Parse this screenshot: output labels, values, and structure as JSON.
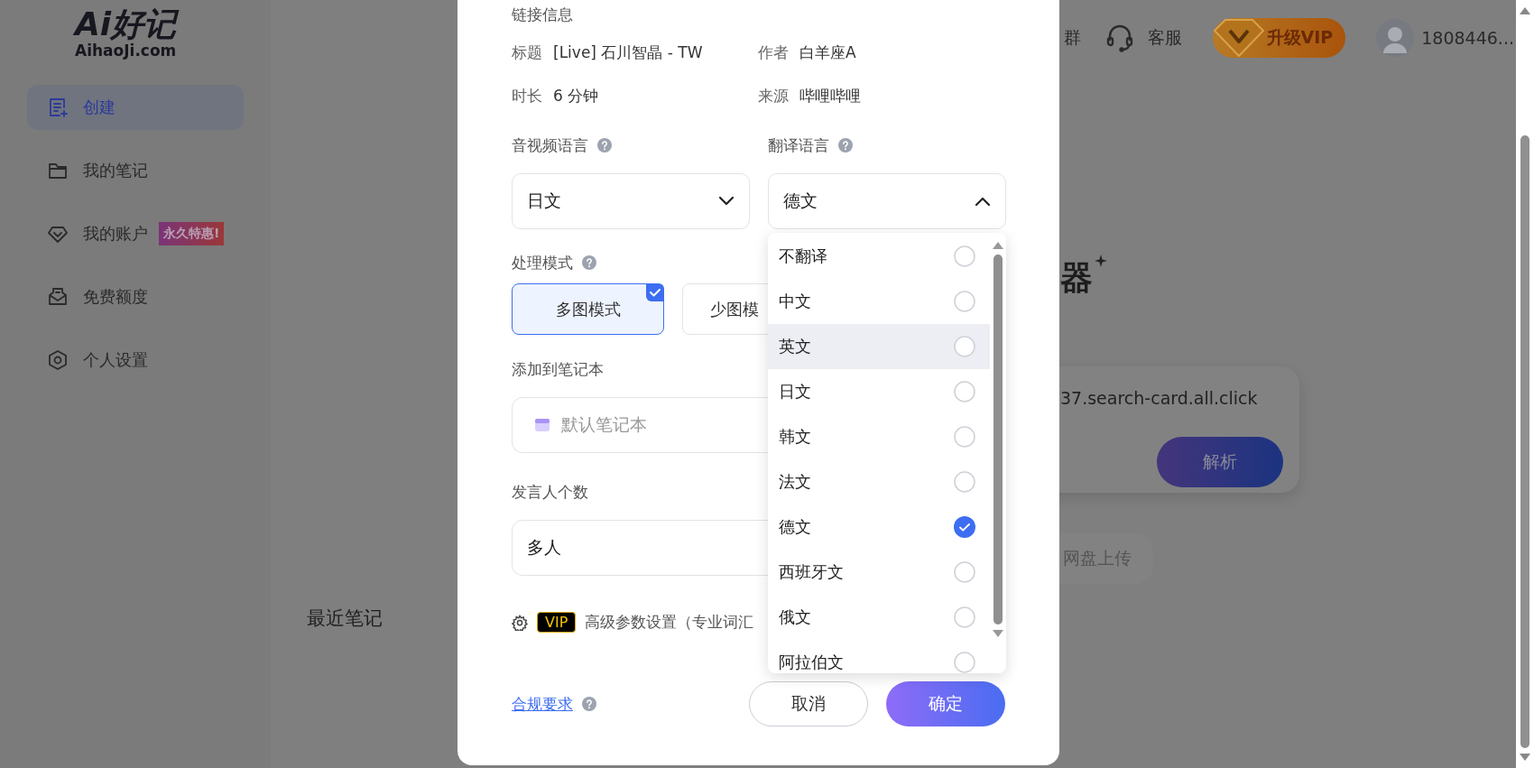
{
  "sidebar": {
    "logo": {
      "mark": "Ai好记",
      "domain": "AihaoJi.com"
    },
    "items": [
      {
        "label": "创建",
        "selected": true
      },
      {
        "label": "我的笔记",
        "selected": false
      },
      {
        "label": "我的账户",
        "selected": false,
        "badge": "永久特惠!"
      },
      {
        "label": "免费额度",
        "selected": false
      },
      {
        "label": "个人设置",
        "selected": false
      }
    ]
  },
  "header": {
    "group_text": "群",
    "service": "客服",
    "vip": "升级VIP",
    "user": "1808446..."
  },
  "background": {
    "title_tail": "器",
    "link_text": "37.search-card.all.click",
    "parse_button": "解析",
    "upload": "网盘上传",
    "recent": "最近笔记"
  },
  "modal": {
    "section": "链接信息",
    "info": [
      {
        "label": "标题",
        "value": "[Live] 石川智晶 - TW"
      },
      {
        "label": "作者",
        "value": "白羊座A"
      },
      {
        "label": "时长",
        "value": "6 分钟"
      },
      {
        "label": "来源",
        "value": "哔哩哔哩"
      }
    ],
    "source_language": {
      "label": "音视频语言",
      "value": "日文",
      "expanded": false
    },
    "target_language": {
      "label": "翻译语言",
      "value": "德文",
      "expanded": true
    },
    "mode": {
      "label": "处理模式",
      "options": [
        {
          "label": "多图模式",
          "selected": true
        },
        {
          "label": "少图模",
          "selected": false
        }
      ]
    },
    "notebook": {
      "label": "添加到笔记本",
      "placeholder": "默认笔记本"
    },
    "speakers": {
      "label": "发言人个数",
      "value": "多人"
    },
    "advanced": {
      "badge": "VIP",
      "text": "高级参数设置（专业词汇"
    },
    "compliance_link": "合规要求",
    "buttons": {
      "cancel": "取消",
      "confirm": "确定"
    },
    "dropdown": {
      "options": [
        {
          "label": "不翻译",
          "selected": false,
          "hovered": false
        },
        {
          "label": "中文",
          "selected": false,
          "hovered": false
        },
        {
          "label": "英文",
          "selected": false,
          "hovered": true
        },
        {
          "label": "日文",
          "selected": false,
          "hovered": false
        },
        {
          "label": "韩文",
          "selected": false,
          "hovered": false
        },
        {
          "label": "法文",
          "selected": false,
          "hovered": false
        },
        {
          "label": "德文",
          "selected": true,
          "hovered": false
        },
        {
          "label": "西班牙文",
          "selected": false,
          "hovered": false
        },
        {
          "label": "俄文",
          "selected": false,
          "hovered": false
        },
        {
          "label": "阿拉伯文",
          "selected": false,
          "hovered": false
        }
      ]
    }
  }
}
